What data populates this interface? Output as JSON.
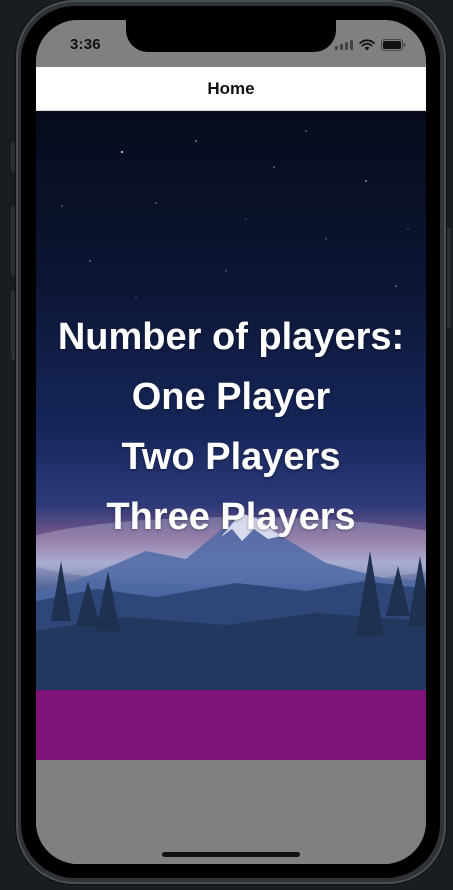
{
  "status_bar": {
    "time": "3:36"
  },
  "nav": {
    "title": "Home"
  },
  "menu": {
    "heading": "Number of players:",
    "options": [
      "One Player",
      "Two Players",
      "Three Players"
    ]
  },
  "colors": {
    "band": "#7f1379",
    "background_gray": "#808080",
    "nav_background": "#ffffff"
  },
  "icons": [
    "signal-icon",
    "wifi-icon",
    "battery-icon"
  ]
}
